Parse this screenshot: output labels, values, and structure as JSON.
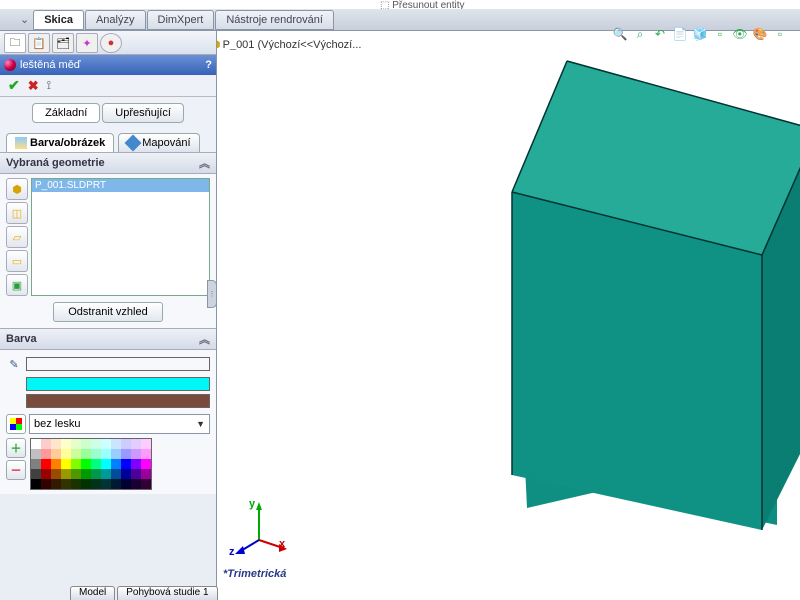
{
  "topbar_hint": "⬚ Přesunout entity",
  "top_tabs": {
    "t0": "Skica",
    "t1": "Analýzy",
    "t2": "DimXpert",
    "t3": "Nástroje rendrování"
  },
  "tree": {
    "part": "P_001 (Výchozí<<Výchozí..."
  },
  "panel": {
    "title": "leštěná měď",
    "help": "?",
    "sub_basic": "Základní",
    "sub_adv": "Upřesňující",
    "tab_color": "Barva/obrázek",
    "tab_map": "Mapování",
    "sec_geom": "Vybraná geometrie",
    "geom_item": "P_001.SLDPRT",
    "remove": "Odstranit vzhled",
    "sec_color": "Barva",
    "gloss": "bez lesku",
    "colors": {
      "primary": "#00f7f7",
      "secondary": "#7a4b3b"
    }
  },
  "viewport": {
    "orientation": "*Trimetrická",
    "axes": {
      "x": "x",
      "y": "y",
      "z": "z"
    }
  },
  "bottom": {
    "model": "Model",
    "study": "Pohybová studie 1"
  }
}
